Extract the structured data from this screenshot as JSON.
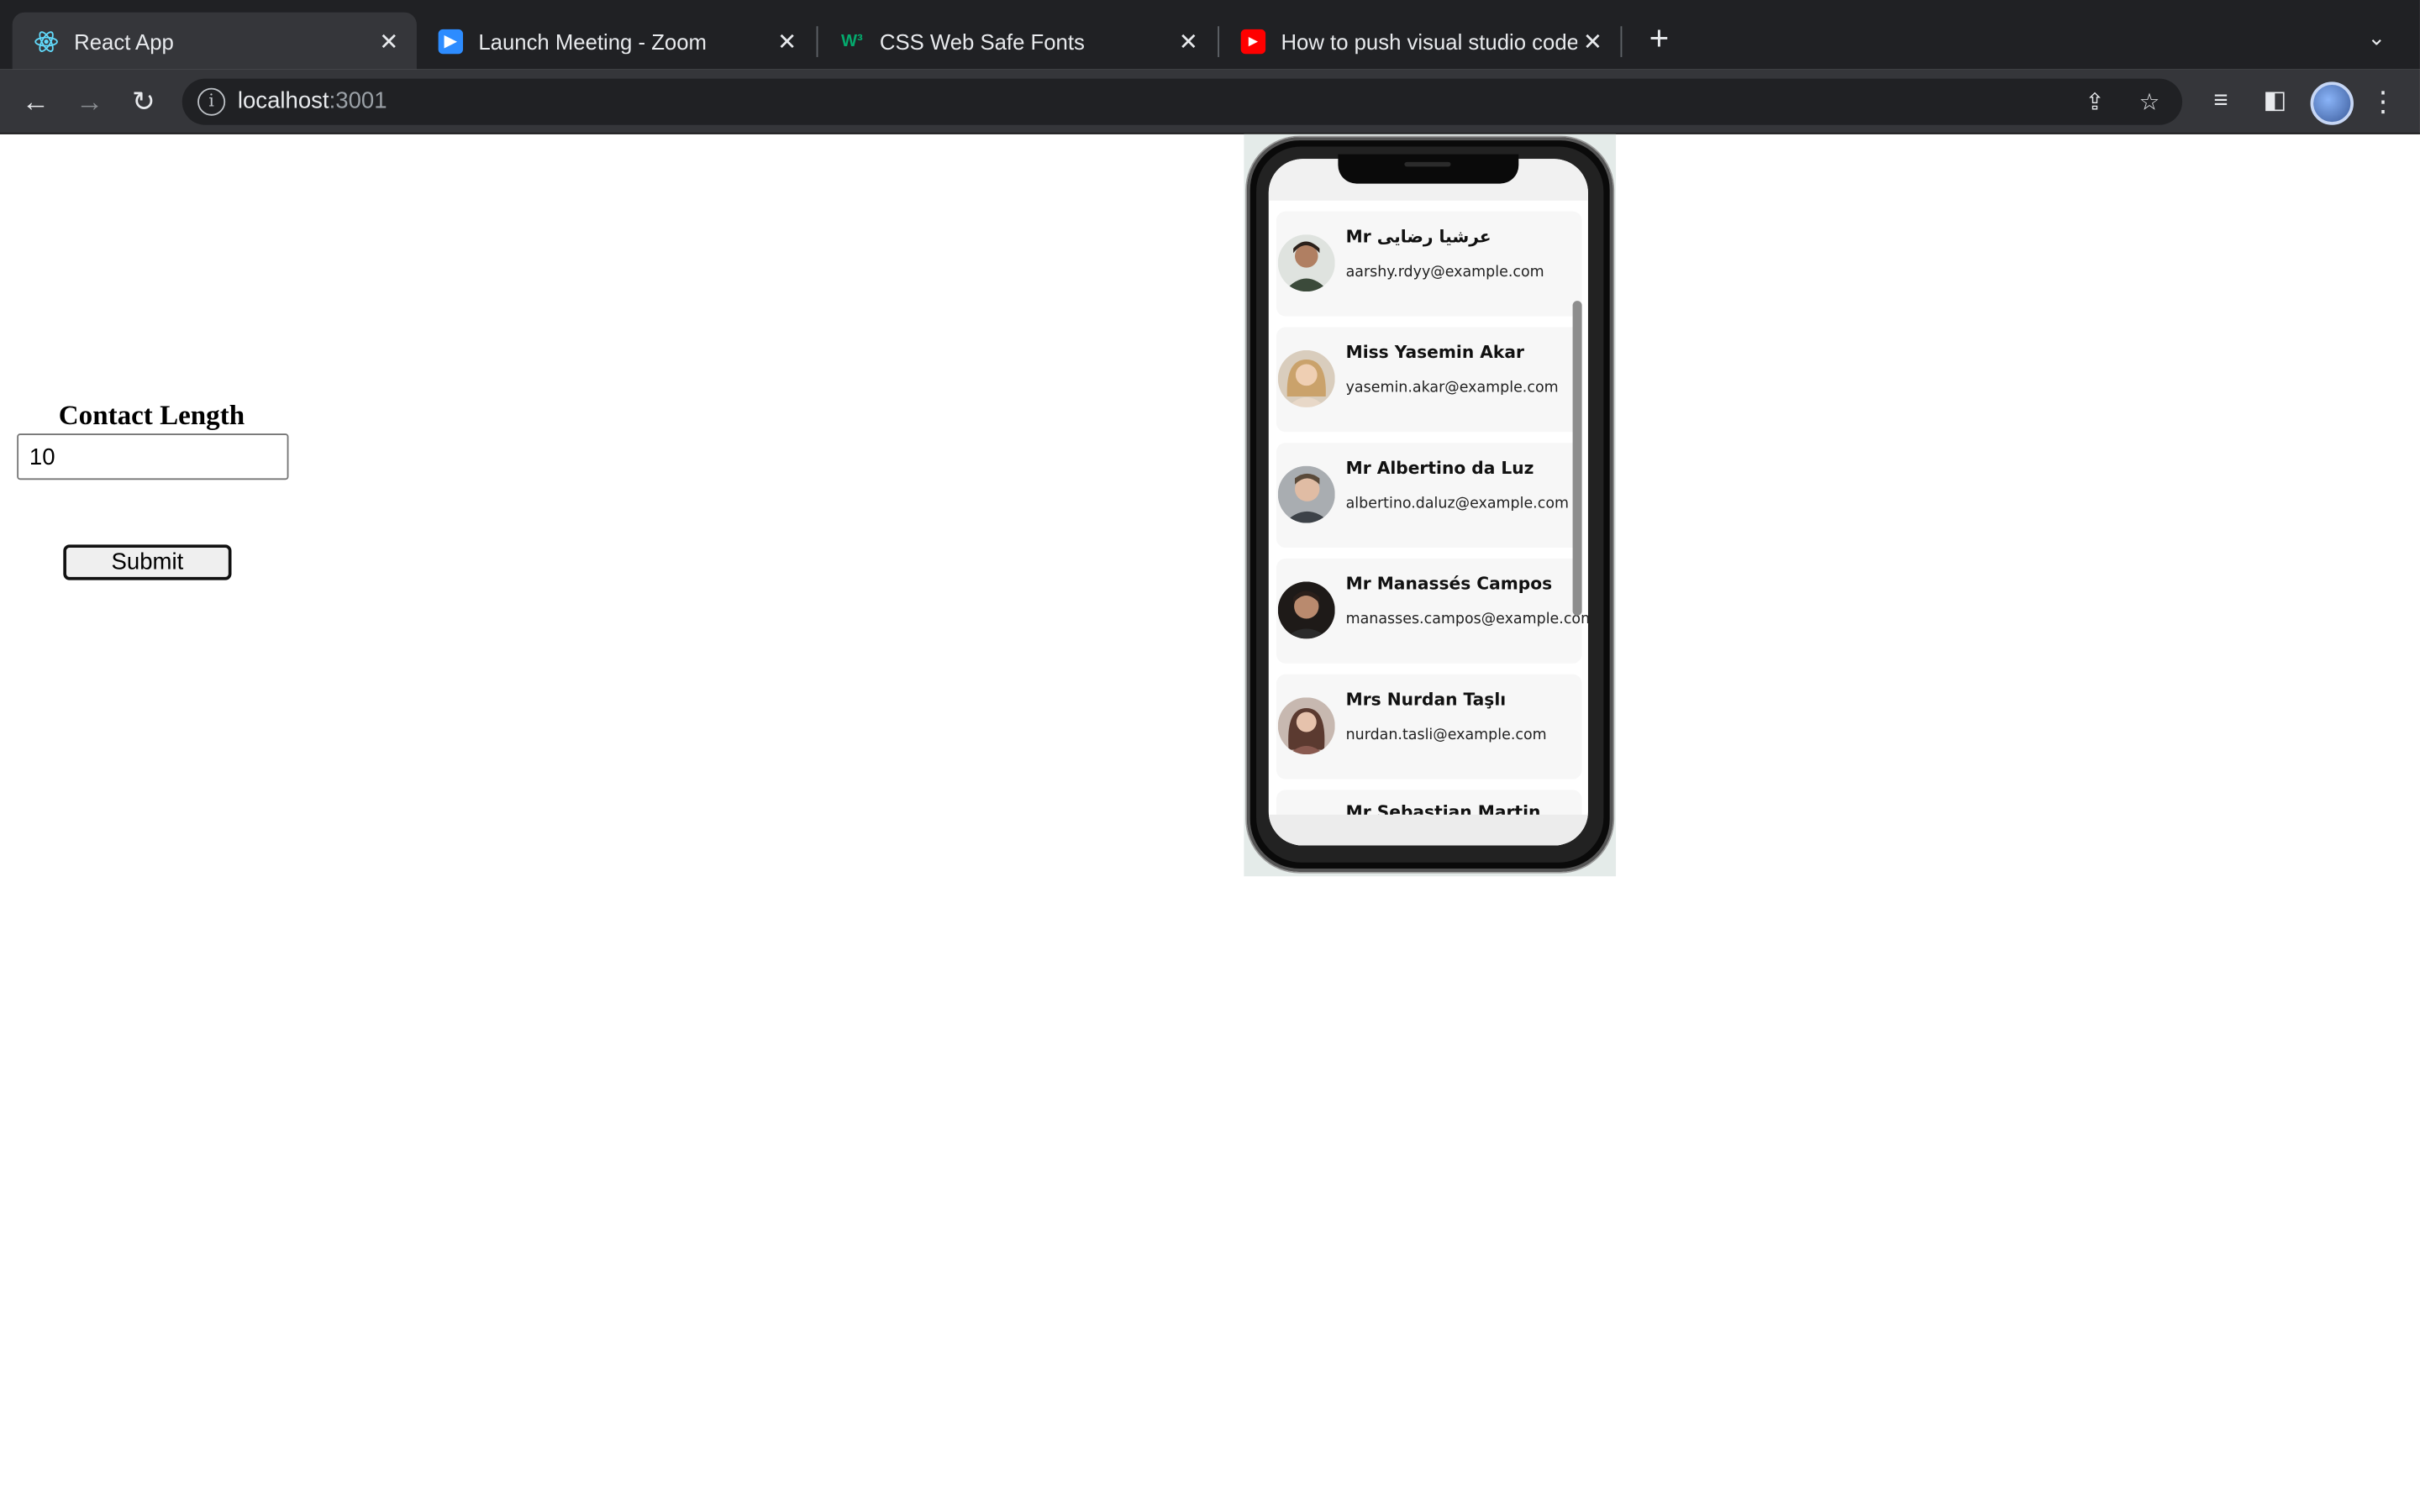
{
  "browser": {
    "tabs": [
      {
        "title": "React App",
        "icon": "react-icon",
        "active": true
      },
      {
        "title": "Launch Meeting - Zoom",
        "icon": "zoom-icon",
        "active": false
      },
      {
        "title": "CSS Web Safe Fonts",
        "icon": "w3schools-icon",
        "active": false
      },
      {
        "title": "How to push visual studio code",
        "icon": "youtube-icon",
        "active": false
      }
    ],
    "address": {
      "host": "localhost",
      "port": ":3001"
    }
  },
  "form": {
    "label": "Contact Length",
    "input_value": "10",
    "submit_label": "Submit"
  },
  "contacts": [
    {
      "name": "Mr عرشیا رضایی",
      "email": "aarshy.rdyy@example.com",
      "avatar_color": "#6a5a4a"
    },
    {
      "name": "Miss Yasemin Akar",
      "email": "yasemin.akar@example.com",
      "avatar_color": "#c9a77a"
    },
    {
      "name": "Mr Albertino da Luz",
      "email": "albertino.daluz@example.com",
      "avatar_color": "#8a8f95"
    },
    {
      "name": "Mr Manassés Campos",
      "email": "manasses.campos@example.com",
      "avatar_color": "#4a3a32"
    },
    {
      "name": "Mrs Nurdan Taşlı",
      "email": "nurdan.tasli@example.com",
      "avatar_color": "#6b4a42"
    },
    {
      "name": "Mr Sebastian Martin",
      "email": "",
      "avatar_color": "#7a6a5a"
    }
  ],
  "colors": {
    "tabstrip": "#202124",
    "toolbar": "#35363a",
    "card": "#f7f7f7"
  }
}
